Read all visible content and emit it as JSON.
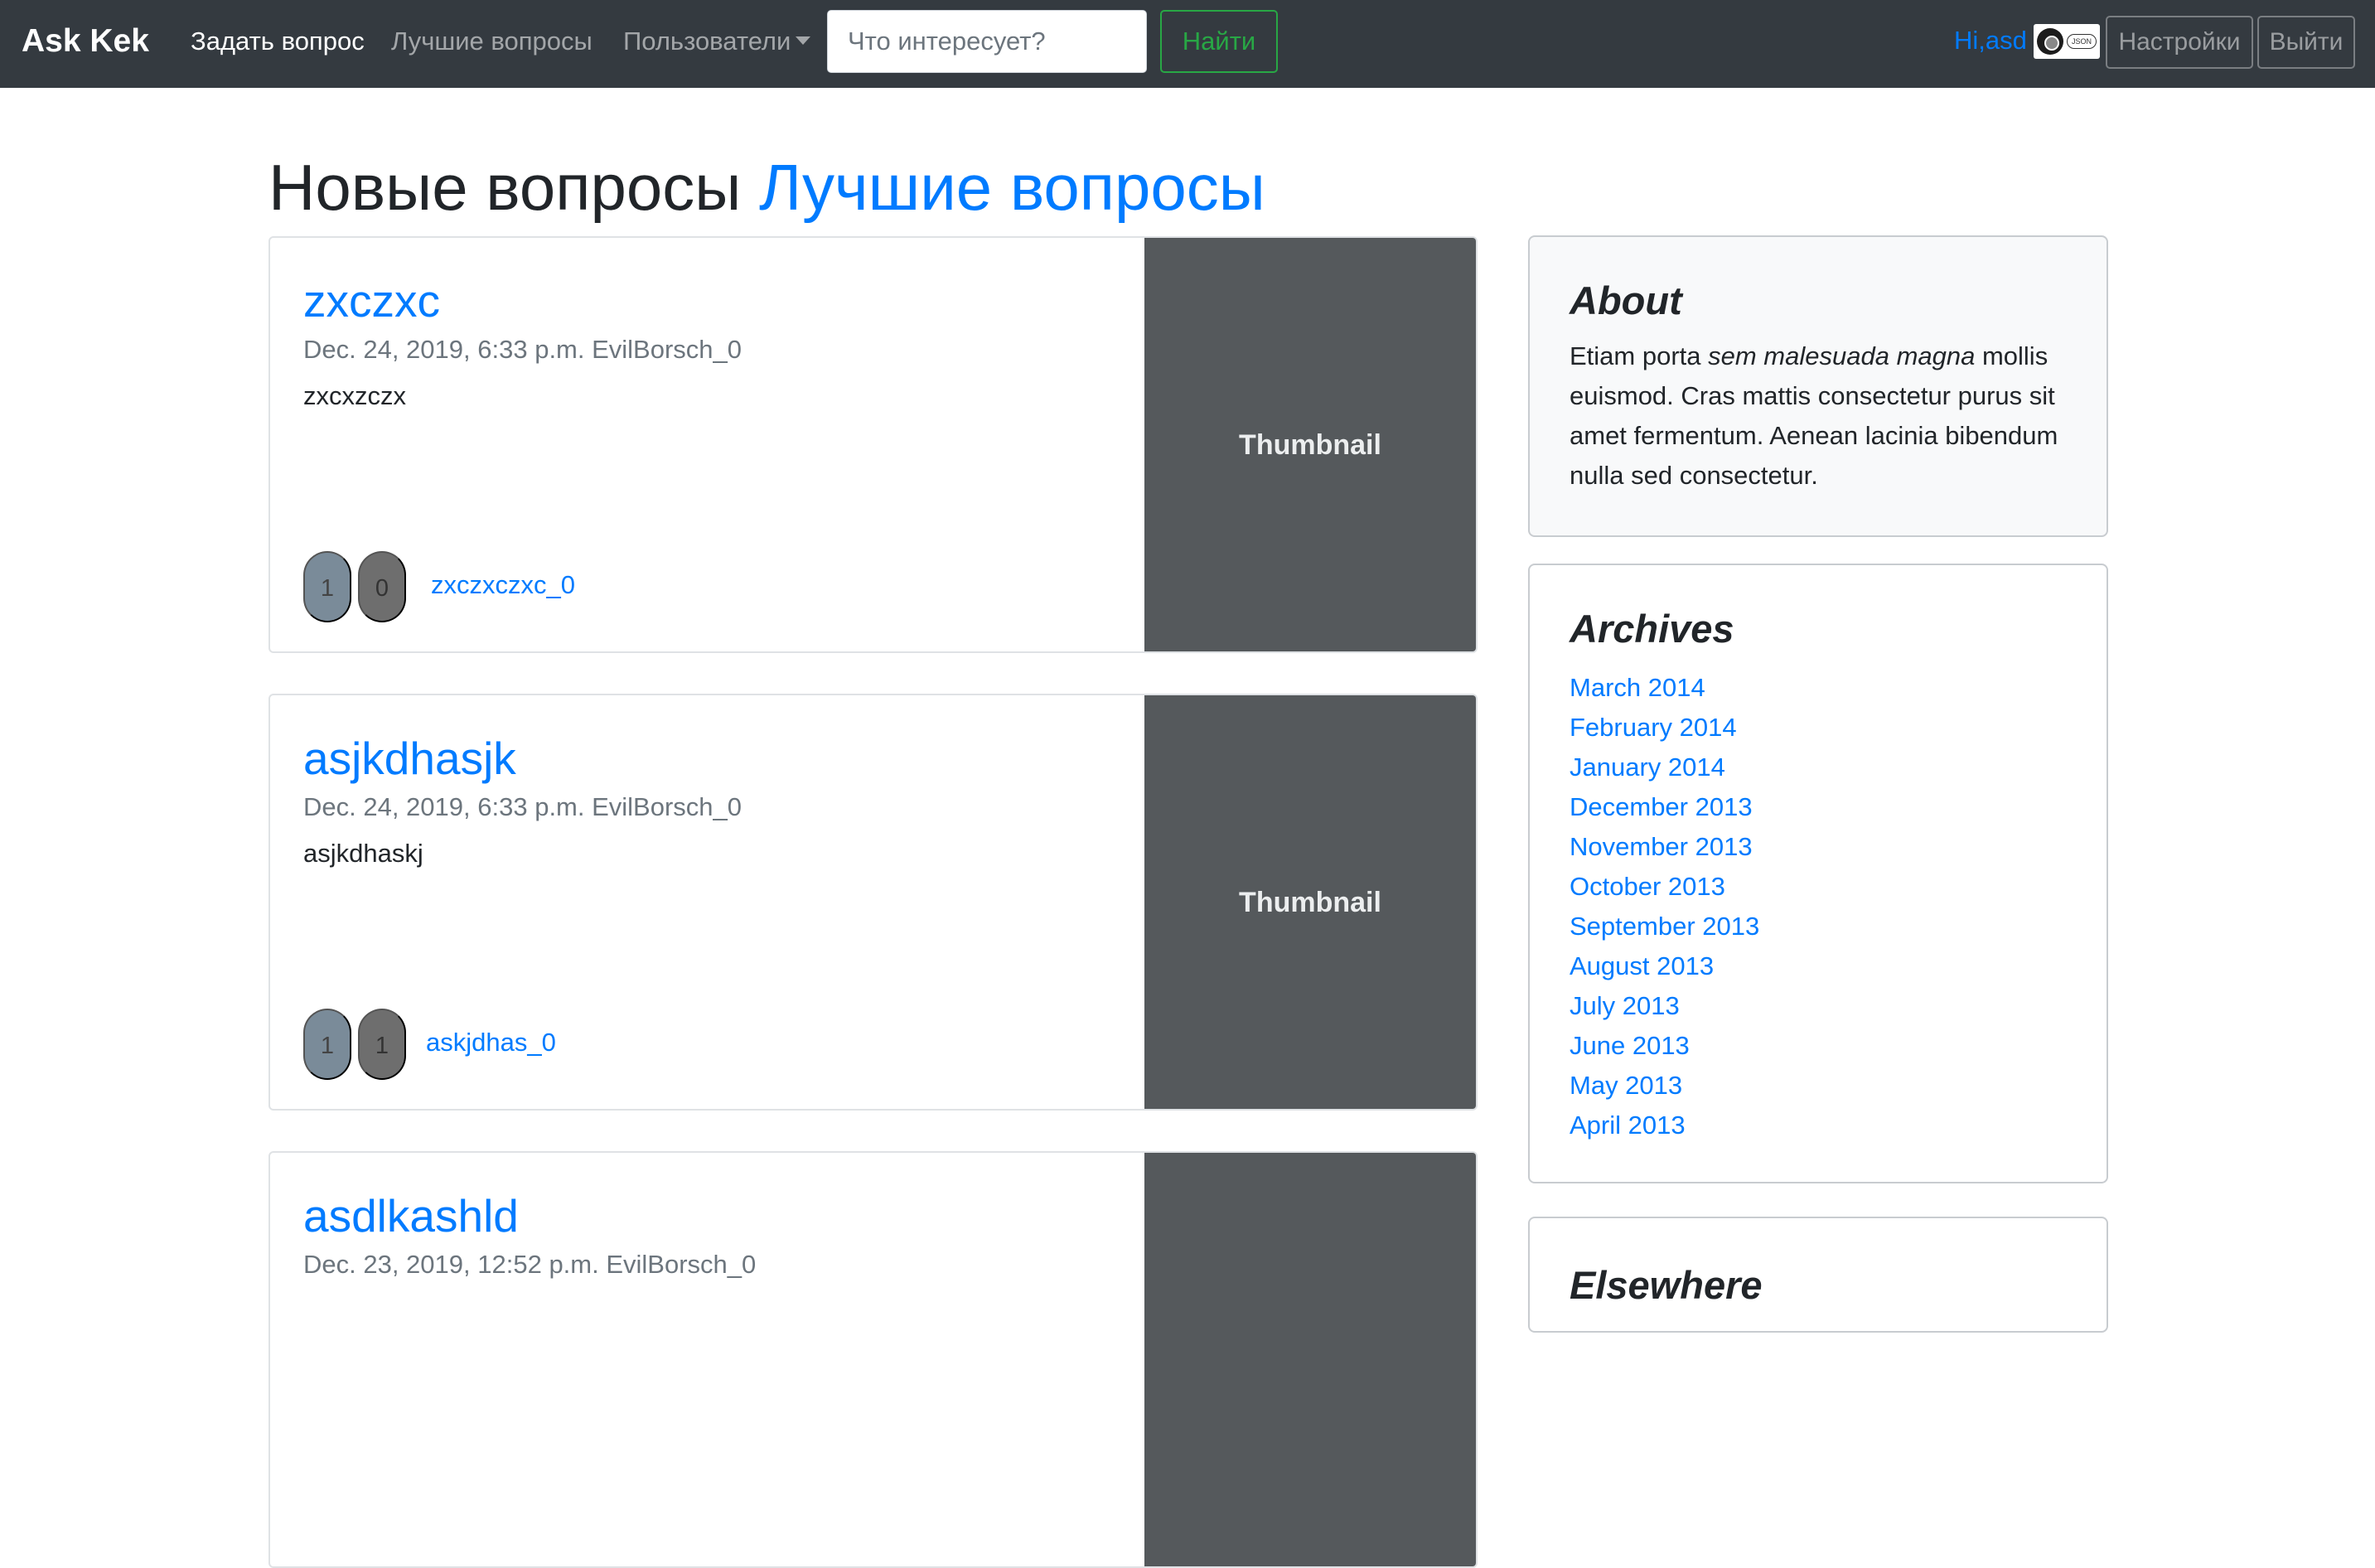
{
  "navbar": {
    "brand": "Ask Kek",
    "links": {
      "ask": "Задать вопрос",
      "best": "Лучшие вопросы",
      "users": "Пользователи"
    },
    "search": {
      "placeholder": "Что интересует?",
      "button": "Найти"
    },
    "greeting": "Hi,asd",
    "avatar_tag": "JSON",
    "settings_button": "Настройки",
    "logout_button": "Выйти"
  },
  "heading": {
    "new": "Новые вопросы",
    "best": "Лучшие вопросы"
  },
  "questions": [
    {
      "title": "zxczxc",
      "meta": "Dec. 24, 2019, 6:33 p.m. EvilBorsch_0",
      "text": "zxcxzczx",
      "likes": "1",
      "dislikes": "0",
      "tag": "zxczxczxc_0",
      "thumbnail": "Thumbnail"
    },
    {
      "title": "asjkdhasjk",
      "meta": "Dec. 24, 2019, 6:33 p.m. EvilBorsch_0",
      "text": "asjkdhaskj",
      "likes": "1",
      "dislikes": "1",
      "tag": "askjdhas_0",
      "thumbnail": "Thumbnail"
    },
    {
      "title": "asdlkashld",
      "meta": "Dec. 23, 2019, 12:52 p.m. EvilBorsch_0",
      "text": "",
      "likes": "",
      "dislikes": "",
      "tag": "",
      "thumbnail": ""
    }
  ],
  "sidebar": {
    "about": {
      "title": "About",
      "text_before": "Etiam porta ",
      "text_em": "sem malesuada magna",
      "text_after": " mollis euismod. Cras mattis consectetur purus sit amet fermentum. Aenean lacinia bibendum nulla sed consectetur."
    },
    "archives": {
      "title": "Archives",
      "items": [
        "March 2014",
        "February 2014",
        "January 2014",
        "December 2013",
        "November 2013",
        "October 2013",
        "September 2013",
        "August 2013",
        "July 2013",
        "June 2013",
        "May 2013",
        "April 2013"
      ]
    },
    "elsewhere": {
      "title": "Elsewhere"
    }
  },
  "colors": {
    "navbar_bg": "#343a40",
    "link": "#007bff",
    "success": "#28a745",
    "thumbnail_bg": "#55595c",
    "sidebar_bg": "#f8f9fa"
  }
}
